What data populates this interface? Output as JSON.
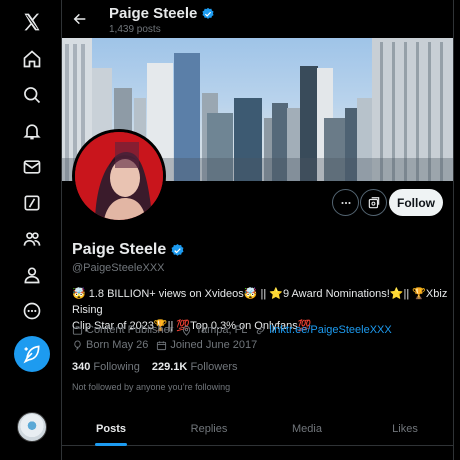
{
  "nav": {
    "logo": "x-logo",
    "items": [
      "home",
      "explore",
      "notifications",
      "messages",
      "grok",
      "communities",
      "profile",
      "more"
    ],
    "post_button": "post-compose"
  },
  "header": {
    "name": "Paige Steele",
    "post_count": "1,439 posts"
  },
  "profile": {
    "name": "Paige Steele",
    "handle": "@PaigeSteeleXXX",
    "bio_line1": "🤯 1.8 BILLION+ views on Xvideos🤯 || ⭐9 Award Nominations!⭐|| 🏆Xbiz Rising",
    "bio_line2": "Clip Star of 2023🏆|| 💯Top 0.3% on Onlyfans💯",
    "category": "Content Publisher",
    "location": "Tampa, FL",
    "link": "linktr.ee/PaigeSteeleXXX",
    "born": "Born May 26",
    "joined": "Joined June 2017",
    "following_count": "340",
    "following_label": "Following",
    "followers_count": "229.1K",
    "followers_label": "Followers",
    "not_followed": "Not followed by anyone you’re following"
  },
  "actions": {
    "follow_label": "Follow"
  },
  "tabs": [
    "Posts",
    "Replies",
    "Media",
    "Likes"
  ],
  "colors": {
    "accent": "#1d9bf0",
    "background": "#000000",
    "muted_text": "#71767b",
    "avatar_bg": "#c9151c"
  }
}
